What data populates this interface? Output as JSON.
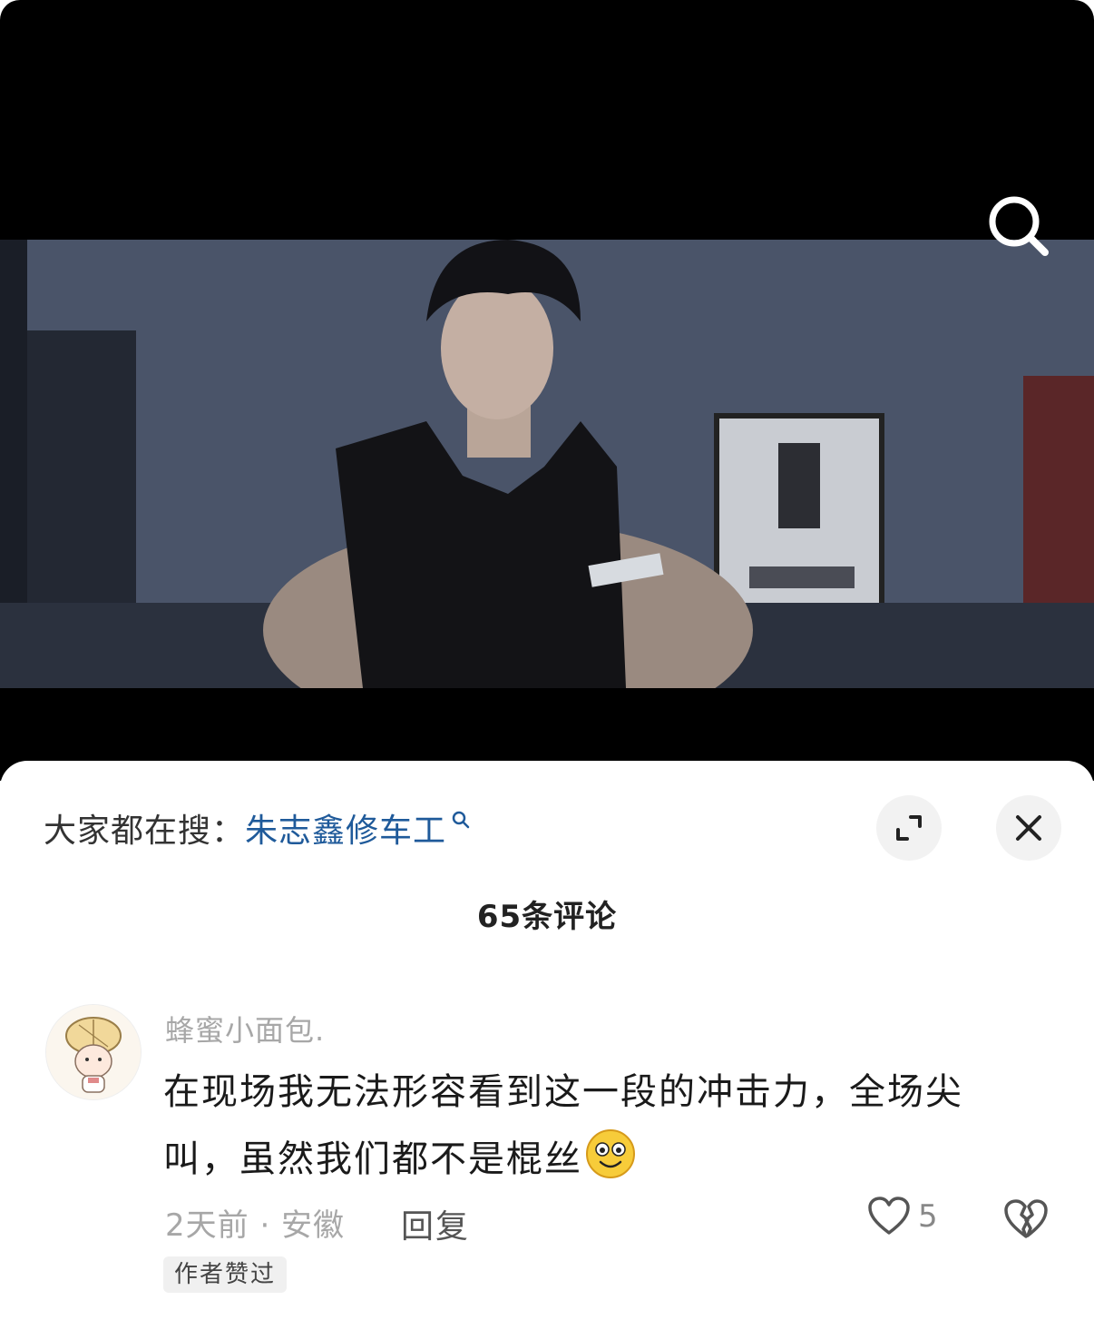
{
  "video": {
    "watermark_icon": "search-icon"
  },
  "search_suggestion": {
    "prefix": "大家都在搜：",
    "term": "朱志鑫修车工",
    "term_icon": "search-icon"
  },
  "header_buttons": {
    "expand_icon": "expand-icon",
    "close_icon": "close-icon"
  },
  "comments_header": {
    "count_label": "65条评论"
  },
  "comment": {
    "username": "蜂蜜小面包.",
    "text": "在现场我无法形容看到这一段的冲击力，全场尖叫，虽然我们都不是棍丝",
    "emoji": "smiling-face-emoji",
    "meta": "2天前 · 安徽",
    "reply_label": "回复",
    "like_count": "5",
    "badge": "作者赞过"
  },
  "colors": {
    "accent_link": "#1f5a9a",
    "muted_text": "#a7a7a7",
    "sheet_bg": "#ffffff",
    "video_bg": "#000000"
  }
}
